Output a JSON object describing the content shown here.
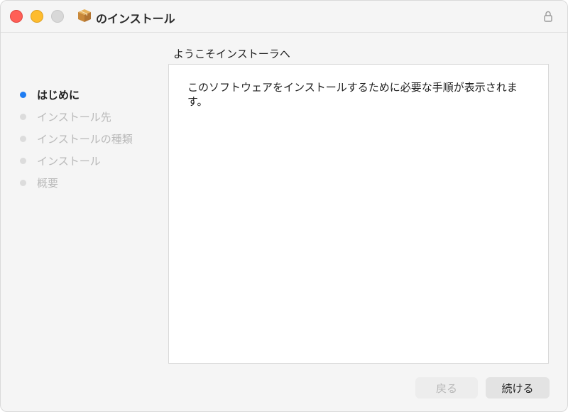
{
  "window": {
    "title": "のインストール",
    "app_icon": "package-icon",
    "lock_icon": "lock-icon"
  },
  "sidebar": {
    "steps": [
      {
        "label": "はじめに",
        "active": true
      },
      {
        "label": "インストール先",
        "active": false
      },
      {
        "label": "インストールの種類",
        "active": false
      },
      {
        "label": "インストール",
        "active": false
      },
      {
        "label": "概要",
        "active": false
      }
    ]
  },
  "main": {
    "heading": "ようこそインストーラへ",
    "body_text": "このソフトウェアをインストールするために必要な手順が表示されます。"
  },
  "buttons": {
    "back_label": "戻る",
    "continue_label": "続ける"
  },
  "colors": {
    "accent": "#1e7cf2",
    "close": "#ff5f57",
    "minimize": "#febc2e",
    "zoom": "#d8d8d8"
  }
}
